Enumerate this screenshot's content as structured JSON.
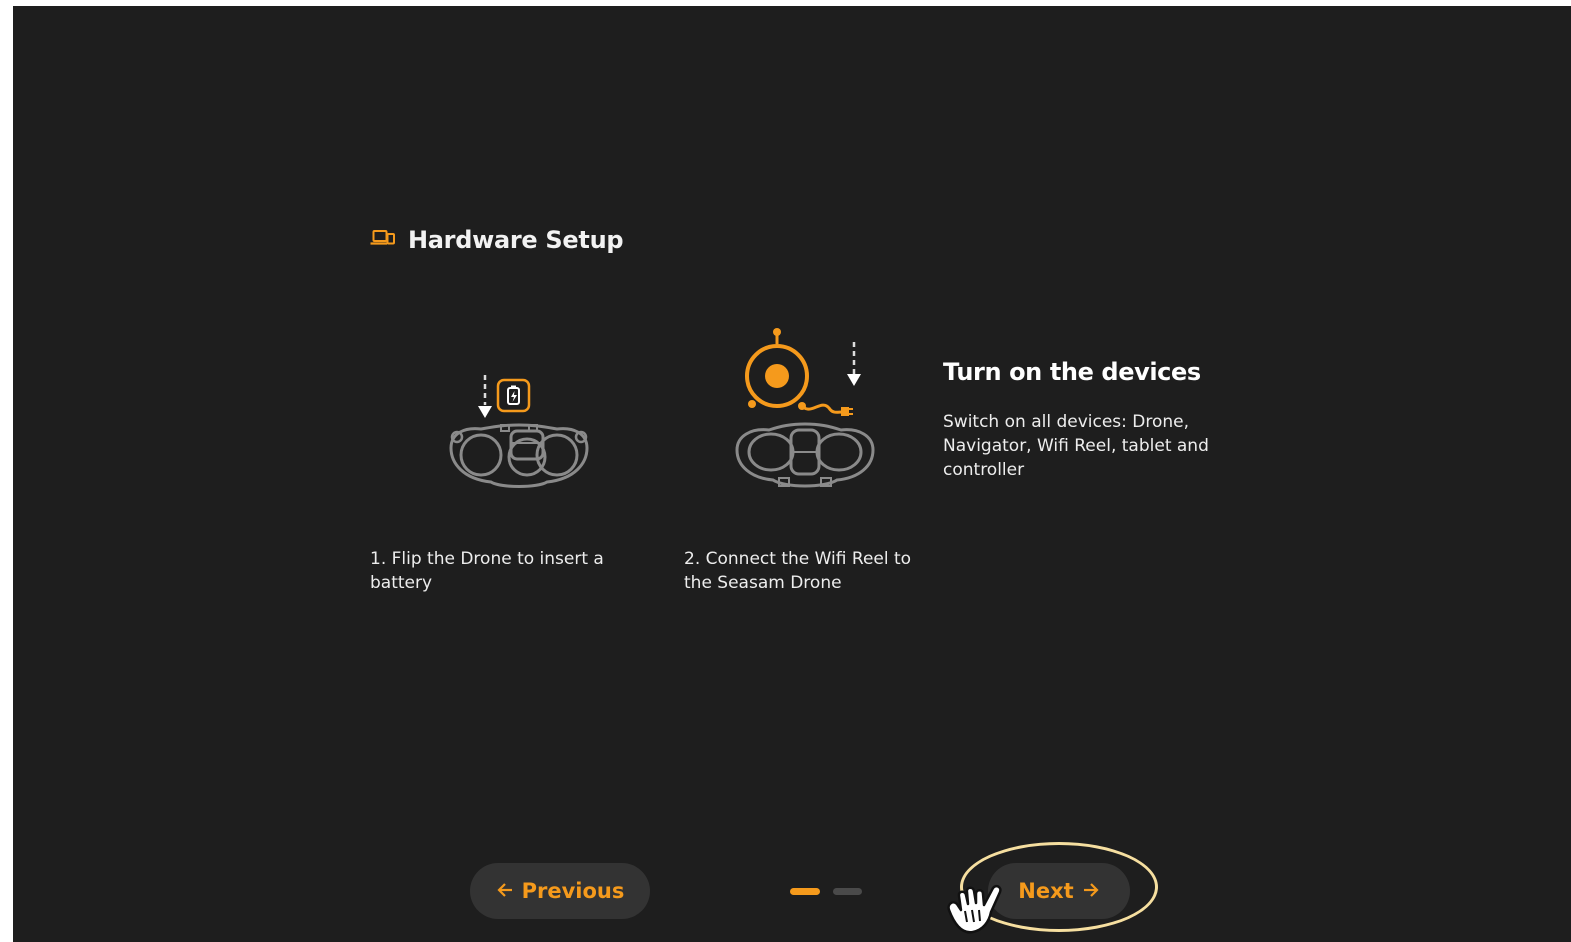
{
  "header": {
    "icon": "devices-icon",
    "title": "Hardware Setup"
  },
  "steps": [
    {
      "illustration": "drone-battery-illustration",
      "text": "1. Flip the Drone to insert a battery"
    },
    {
      "illustration": "drone-wifi-reel-illustration",
      "text": "2. Connect the Wifi Reel to the Seasam Drone"
    }
  ],
  "info": {
    "title": "Turn on the devices",
    "description": "Switch on all devices: Drone, Navigator, Wifi Reel, tablet and controller"
  },
  "nav": {
    "previous_label": "Previous",
    "next_label": "Next",
    "previous_icon": "arrow-left-icon",
    "next_icon": "arrow-right-icon"
  },
  "pagination": {
    "current_page": 1,
    "total_pages": 2
  },
  "colors": {
    "accent": "#f59a1c",
    "background": "#1e1e1e",
    "button_background": "#333333",
    "highlight": "#f6dfa0"
  }
}
